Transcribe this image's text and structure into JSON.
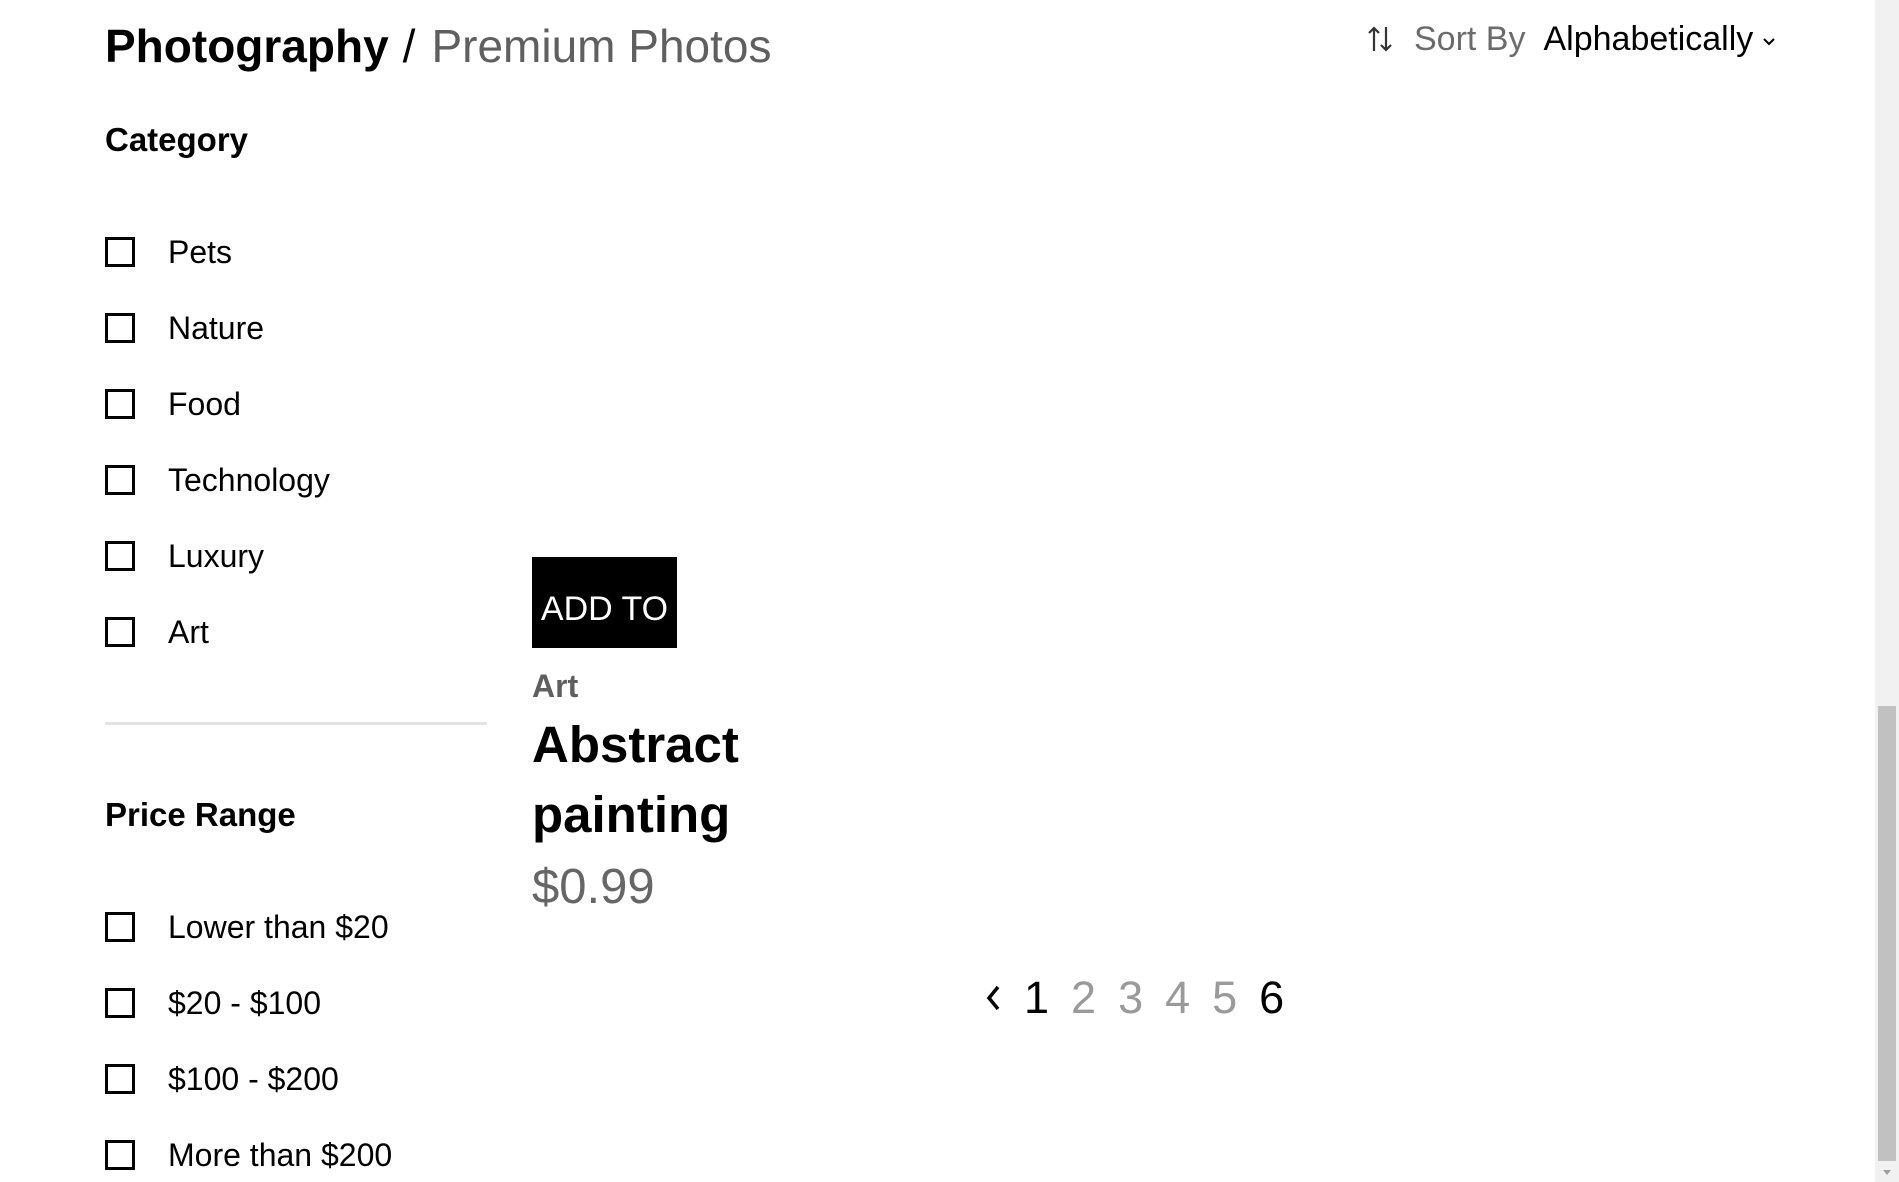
{
  "header": {
    "breadcrumb_root": "Photography",
    "breadcrumb_sep": "/",
    "breadcrumb_current": "Premium Photos",
    "sort_label": "Sort By",
    "sort_value": "Alphabetically"
  },
  "sidebar": {
    "category_title": "Category",
    "categories": [
      "Pets",
      "Nature",
      "Food",
      "Technology",
      "Luxury",
      "Art"
    ],
    "price_title": "Price Range",
    "prices": [
      "Lower than $20",
      "$20 - $100",
      "$100 - $200",
      "More than $200"
    ]
  },
  "product": {
    "button_label": "ADD TO",
    "category": "Art",
    "title": "Abstract painting",
    "price": "$0.99"
  },
  "pagination": {
    "pages": [
      "1",
      "2",
      "3",
      "4",
      "5",
      "6"
    ],
    "current": "1"
  },
  "icons": {
    "sort": "sort-arrows-icon",
    "chevron": "chevron-down-icon",
    "prev": "chevron-left-icon"
  }
}
